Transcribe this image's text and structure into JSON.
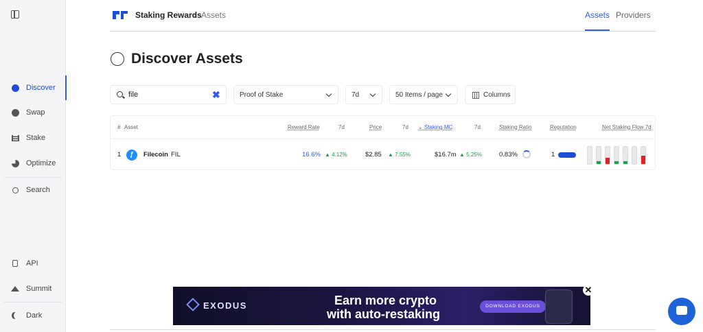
{
  "sidebar": {
    "items": [
      {
        "label": "Discover",
        "icon": "compass-icon",
        "active": true
      },
      {
        "label": "Swap",
        "icon": "swap-icon"
      },
      {
        "label": "Stake",
        "icon": "stake-icon"
      },
      {
        "label": "Optimize",
        "icon": "pie-chart-icon"
      },
      {
        "label": "Search",
        "icon": "search-icon"
      }
    ],
    "bottom_items": [
      {
        "label": "API",
        "icon": "lock-icon"
      },
      {
        "label": "Summit",
        "icon": "mountain-icon"
      },
      {
        "label": "Dark",
        "icon": "moon-icon"
      }
    ]
  },
  "header": {
    "brand": "Staking Rewards",
    "separator": "›",
    "breadcrumb": "Assets",
    "nav": [
      "Assets",
      "Providers"
    ]
  },
  "page": {
    "title": "Discover Assets"
  },
  "filters": {
    "search_value": "file",
    "clear_icon": "✖",
    "consensus": "Proof of Stake",
    "period": "7d",
    "page_size": "50 Items / page",
    "columns_label": "Columns"
  },
  "table": {
    "headers": {
      "num": "#",
      "asset": "Asset",
      "reward_rate": "Reward Rate",
      "rr_period": "7d",
      "price": "Price",
      "price_period": "7d",
      "staking_mc": "Staking MC",
      "mc_period": "7d",
      "staking_ratio": "Staking Ratio",
      "reputation": "Reputation",
      "net_flow": "Net Staking Flow 7d"
    },
    "rows": [
      {
        "rank": "1",
        "logo": "ƒ",
        "name": "Filecoin",
        "symbol": "FIL",
        "reward_rate": "16.6%",
        "reward_change": "▲ 4.12%",
        "price": "$2.85",
        "price_change": "▲ 7.55%",
        "staking_mc": "$16.7m",
        "mc_change": "▲ 5.25%",
        "staking_ratio": "0.83%",
        "reputation": "1",
        "net_flow_bars": [
          {
            "value": 0.1,
            "color": "#e8e8ea"
          },
          {
            "value": 0.15,
            "color": "#16a34a"
          },
          {
            "value": 0.35,
            "color": "#dc2626"
          },
          {
            "value": 0.15,
            "color": "#16a34a"
          },
          {
            "value": 0.15,
            "color": "#16a34a"
          },
          {
            "value": 0.1,
            "color": "#e8e8ea"
          },
          {
            "value": 0.5,
            "color": "#dc2626"
          }
        ]
      }
    ]
  },
  "ad": {
    "brand": "EXODUS",
    "line1": "Earn more crypto",
    "line2": "with auto-restaking",
    "cta": "DOWNLOAD EXODUS",
    "close": "✕"
  },
  "colors": {
    "accent": "#2f5bea",
    "positive": "#16a34a",
    "negative": "#dc2626"
  }
}
